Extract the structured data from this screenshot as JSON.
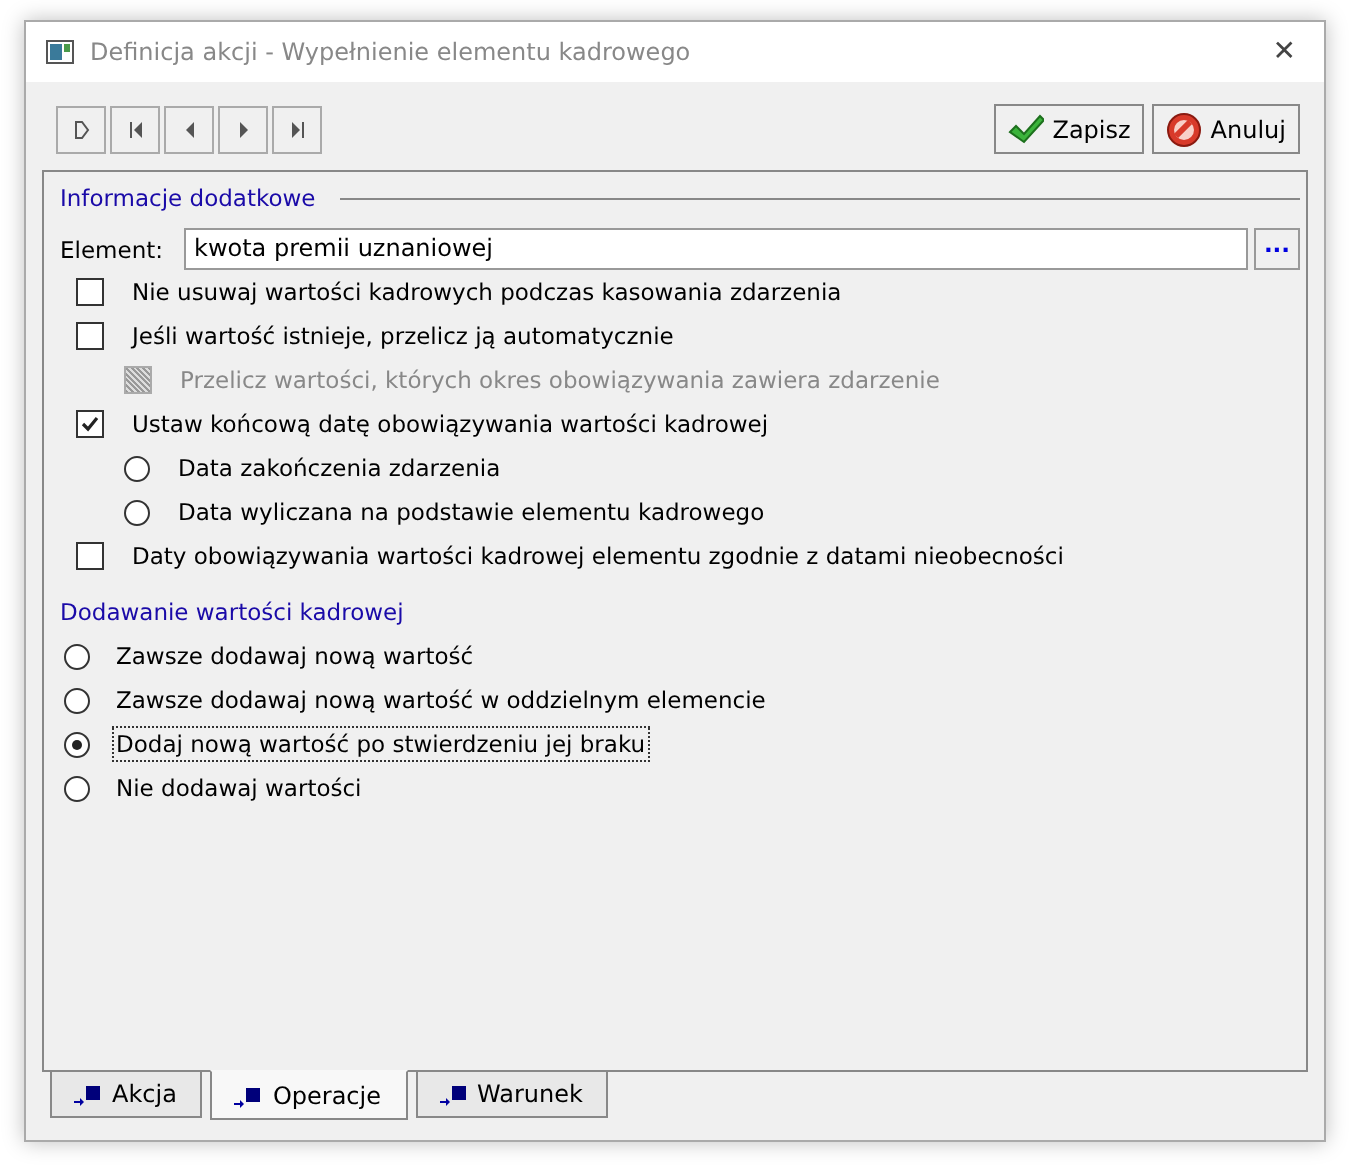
{
  "window": {
    "title": "Definicja akcji - Wypełnienie elementu kadrowego",
    "close": "✕"
  },
  "toolbar": {
    "buttons": [
      {
        "label": "Zapisz",
        "kind": "save"
      },
      {
        "label": "Anuluj",
        "kind": "cancel"
      }
    ]
  },
  "section_1": {
    "title": "Informacje dodatkowe",
    "element_label": "Element:",
    "element_value": "kwota premii uznaniowej",
    "browse": "...",
    "options": [
      {
        "kind": "checkbox",
        "label": "Nie usuwaj wartości kadrowych podczas kasowania zdarzenia",
        "checked": false,
        "disabled": false
      },
      {
        "kind": "checkbox",
        "label": "Jeśli wartość istnieje, przelicz ją automatycznie",
        "checked": false,
        "disabled": false,
        "children": [
          {
            "kind": "checkbox",
            "label": "Przelicz wartości, których okres obowiązywania zawiera zdarzenie",
            "indeterminate": true,
            "disabled": true
          }
        ]
      },
      {
        "kind": "checkbox",
        "label": "Ustaw końcową datę obowiązywania wartości kadrowej",
        "checked": true,
        "disabled": false,
        "children": [
          {
            "kind": "radio",
            "label": "Data zakończenia zdarzenia",
            "selected": false,
            "disabled": false
          },
          {
            "kind": "radio",
            "label": "Data wyliczana na podstawie elementu kadrowego",
            "selected": false,
            "disabled": false
          }
        ]
      },
      {
        "kind": "checkbox",
        "label": "Daty obowiązywania wartości kadrowej elementu zgodnie z datami nieobecności",
        "checked": false,
        "disabled": false
      }
    ]
  },
  "section_2": {
    "title": "Dodawanie wartości kadrowej",
    "options": [
      {
        "kind": "radio",
        "label": "Zawsze dodawaj nową wartość",
        "selected": false,
        "disabled": false
      },
      {
        "kind": "radio",
        "label": "Zawsze dodawaj nową wartość w oddzielnym elemencie",
        "selected": false,
        "disabled": false
      },
      {
        "kind": "radio",
        "label": "Dodaj nową wartość po stwierdzeniu jej braku",
        "selected": true,
        "disabled": false
      },
      {
        "kind": "radio",
        "label": "Nie dodawaj wartości",
        "selected": false,
        "disabled": false
      }
    ]
  },
  "tabs": [
    {
      "label": "Akcja",
      "selected": false
    },
    {
      "label": "Operacje",
      "selected": true
    },
    {
      "label": "Warunek",
      "selected": false
    }
  ]
}
